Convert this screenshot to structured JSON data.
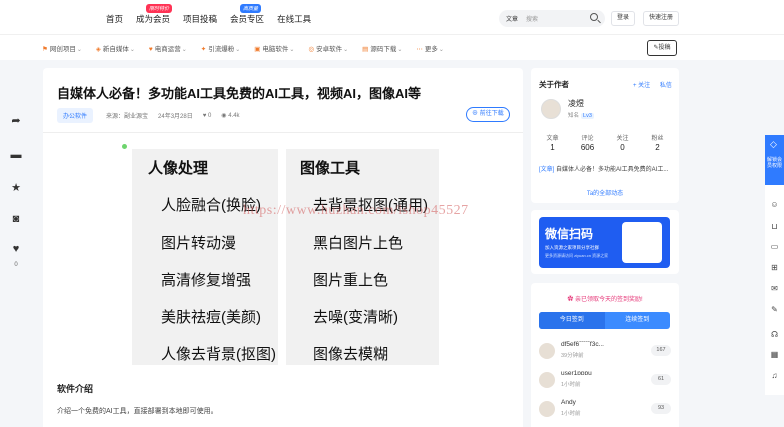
{
  "nav": {
    "items": [
      {
        "label": "首页",
        "badge": ""
      },
      {
        "label": "成为会员",
        "badge": "限时特价"
      },
      {
        "label": "项目投稿",
        "badge": ""
      },
      {
        "label": "会员专区",
        "badge": "高质量"
      },
      {
        "label": "在线工具",
        "badge": ""
      }
    ],
    "search_select": "文章",
    "search_placeholder": "搜索",
    "login": "登录",
    "register": "快速注册",
    "post": "投稿"
  },
  "categories": [
    {
      "icon": "⚑",
      "label": "网创项目"
    },
    {
      "icon": "◈",
      "label": "新自媒体"
    },
    {
      "icon": "♥",
      "label": "电商运营"
    },
    {
      "icon": "✦",
      "label": "引流爆粉"
    },
    {
      "icon": "▣",
      "label": "电脑软件"
    },
    {
      "icon": "◎",
      "label": "安卓软件"
    },
    {
      "icon": "▤",
      "label": "源码下载"
    },
    {
      "icon": "⋯",
      "label": "更多"
    }
  ],
  "left_actions": {
    "like_count": "0"
  },
  "article": {
    "title": "自媒体人必备！多功能AI工具免费的AI工具，视频AI，图像AI等",
    "tag": "办公软件",
    "source": "来源：副业源宝",
    "date": "24年3月28日",
    "likes": "0",
    "views": "4.4k",
    "go_download": "前往下载",
    "promo": {
      "left_header": "人像处理",
      "left_items": [
        "人脸融合(换脸)",
        "图片转动漫",
        "高清修复增强",
        "美肤祛痘(美颜)",
        "人像去背景(抠图)"
      ],
      "right_header": "图像工具",
      "right_items": [
        "去背景抠图(通用)",
        "黑白图片上色",
        "图片重上色",
        "去噪(变清晰)",
        "图像去模糊"
      ]
    },
    "watermark": "https://www.huzhan.com/ishop45527",
    "section_title": "软件介绍",
    "description": "介绍一个免费的AI工具，直接部署到本地即可使用。"
  },
  "author_card": {
    "heading": "关于作者",
    "follow": "+ 关注",
    "message": "私信",
    "name": "凌煜",
    "bio": "知名",
    "level": "Lv3",
    "stats": [
      {
        "label": "文章",
        "value": "1"
      },
      {
        "label": "评论",
        "value": "606"
      },
      {
        "label": "关注",
        "value": "0"
      },
      {
        "label": "粉丝",
        "value": "2"
      }
    ],
    "last_post_tag": "[文章]",
    "last_post": "自媒体人必备！多功能AI工具免费的AI工...",
    "all_link": "Ta的全部动态"
  },
  "wechat_card": {
    "title": "微信扫码",
    "subtitle": "加入资源之家项目分享社群",
    "subtitle2": "更多资源请访问 ziyuan.cn 资源之家"
  },
  "sign_card": {
    "tip": "✿ 亲已领取今天的签到奖励!",
    "today": "今日签到",
    "ranking": "连续签到",
    "users": [
      {
        "name": "df5ef6ˉˉˉˉˉf3c...",
        "time": "39分钟前",
        "points": "167"
      },
      {
        "name": "user1ɒɒɒu",
        "time": "1小时前",
        "points": "61"
      },
      {
        "name": "Andy",
        "time": "1小时前",
        "points": "93"
      }
    ]
  },
  "right_float": {
    "tab_label": "解锁会员权限"
  }
}
